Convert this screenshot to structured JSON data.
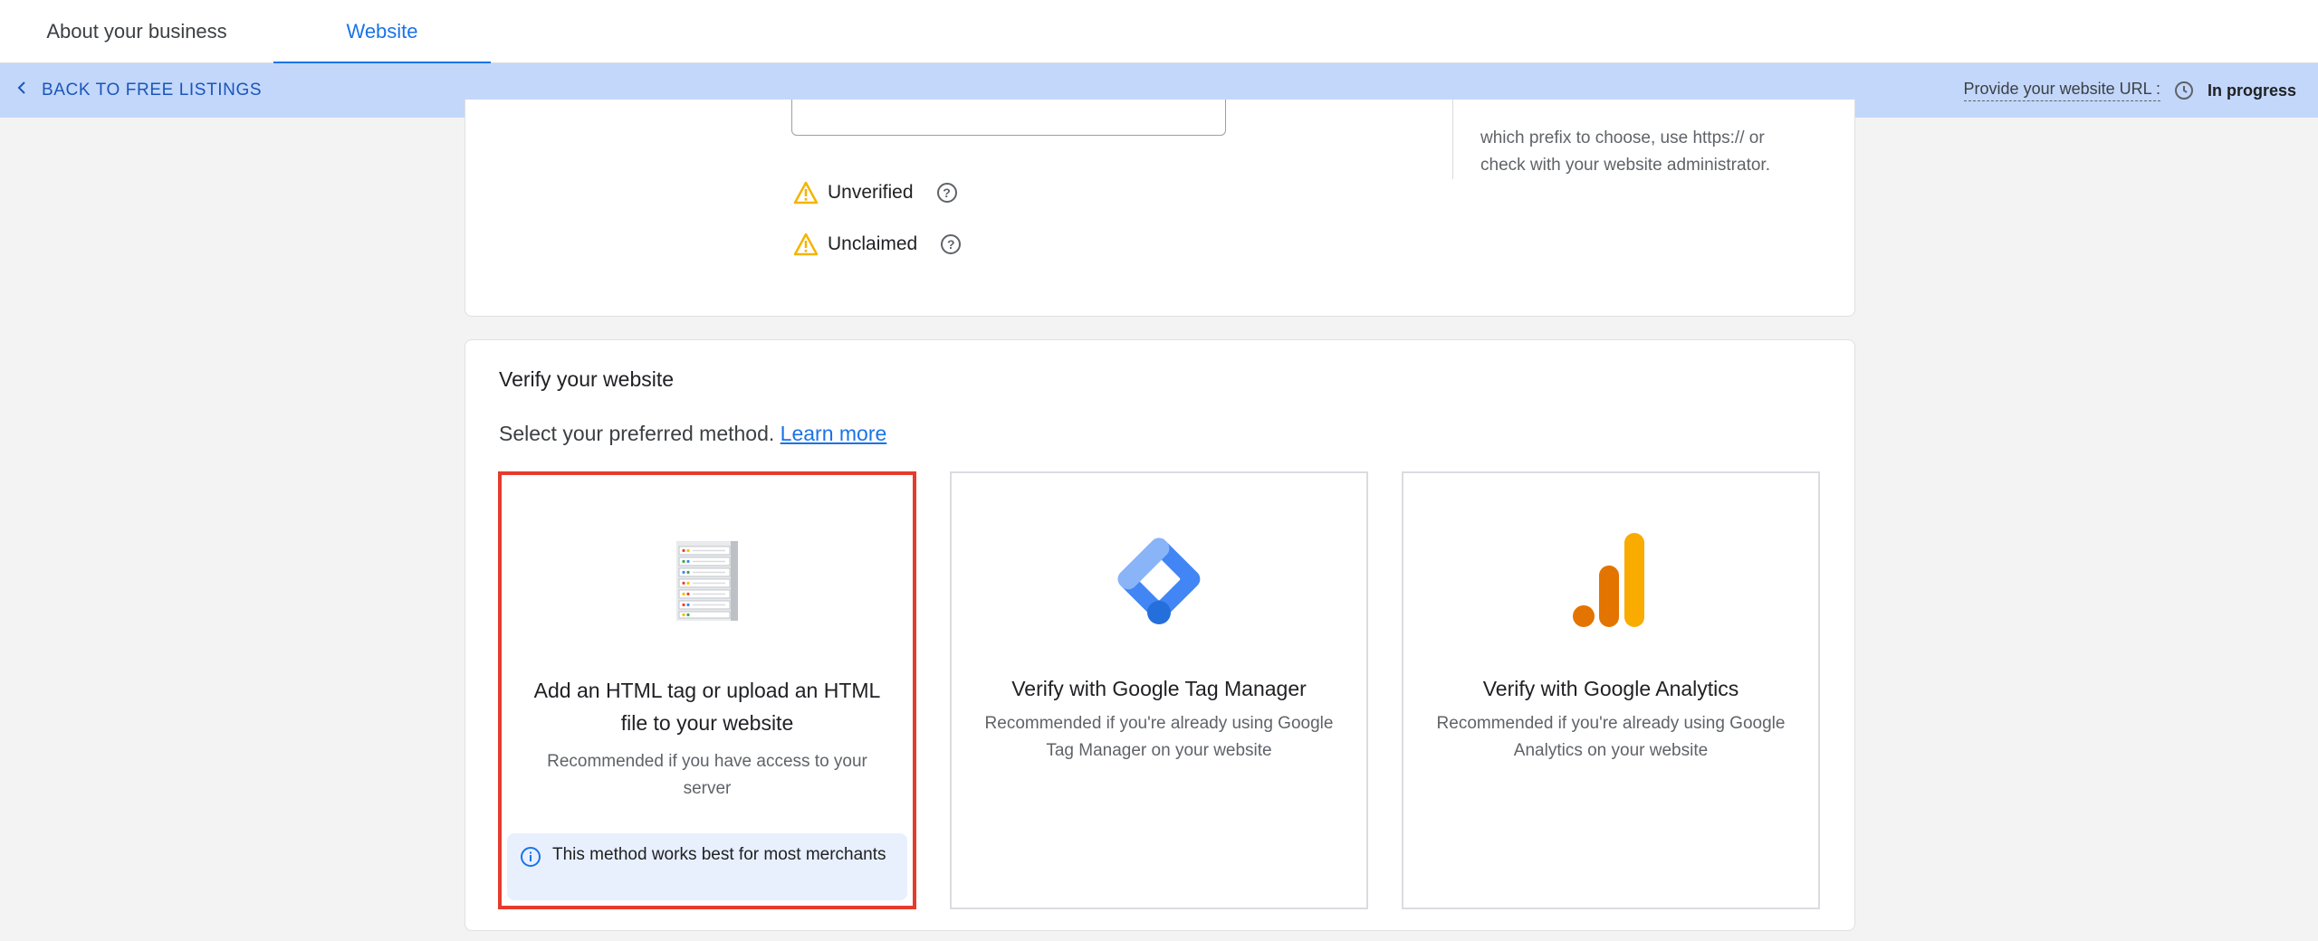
{
  "tabs": [
    {
      "label": "About your business",
      "active": false
    },
    {
      "label": "Website",
      "active": true
    }
  ],
  "banner": {
    "back_label": "BACK TO FREE LISTINGS",
    "status_label": "Provide your website URL :",
    "status_value": "In progress",
    "back_icon": "chevron-left-icon",
    "status_icon": "clock-icon"
  },
  "website_card": {
    "help_text_line1": "which prefix to choose, use https:// or",
    "help_text_line2": "check with your website administrator.",
    "statuses": [
      {
        "label": "Unverified",
        "icon": "warning-icon"
      },
      {
        "label": "Unclaimed",
        "icon": "warning-icon"
      }
    ],
    "help_icon": "help-icon"
  },
  "verify_card": {
    "title": "Verify your website",
    "subtitle": "Select your preferred method.",
    "learn_more": "Learn more",
    "options": [
      {
        "title": "Add an HTML tag or upload an HTML file to your website",
        "description": "Recommended if you have access to your server",
        "icon": "server-icon",
        "selected": true,
        "tip": "This method works best for most merchants"
      },
      {
        "title": "Verify with Google Tag Manager",
        "description": "Recommended if you're already using Google Tag Manager on your website",
        "icon": "google-tag-manager-icon",
        "selected": false
      },
      {
        "title": "Verify with Google Analytics",
        "description": "Recommended if you're already using Google Analytics on your website",
        "icon": "google-analytics-icon",
        "selected": false
      }
    ]
  },
  "colors": {
    "accent": "#1a73e8",
    "banner": "#c3d7fb",
    "selected_border": "#e53b2c",
    "warning": "#f4b400"
  }
}
